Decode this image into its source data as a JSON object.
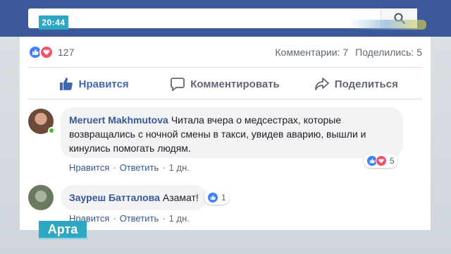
{
  "overlay": {
    "time": "20:44",
    "channel_logo": "Арта"
  },
  "header": {
    "search_placeholder": "",
    "search_icon": "search-icon"
  },
  "post": {
    "reactions": {
      "icons": [
        "like-icon",
        "love-icon"
      ],
      "count": "127"
    },
    "comments_count_label": "Комментарии: 7",
    "shares_count_label": "Поделились: 5",
    "actions": {
      "like_label": "Нравится",
      "comment_label": "Комментировать",
      "share_label": "Поделиться"
    }
  },
  "comments": [
    {
      "author": "Meruert Makhmutova",
      "text_line1": "Читала вчера о медсестрах, которые",
      "text_line2": "возвращались с ночной смены в такси, увидев аварию, вышли и",
      "text_line3": "кинулись помогать людям.",
      "reaction_count": "5",
      "like_label": "Нравится",
      "reply_label": "Ответить",
      "separator": "·",
      "time": "1 дн."
    },
    {
      "author": "Зауреш Батталова",
      "text": "Азамат!",
      "reaction_count": "1",
      "like_label": "Нравится",
      "reply_label": "Ответить",
      "separator": "·",
      "time": "1 дн."
    }
  ],
  "colors": {
    "facebook_blue": "#3b5998",
    "link_blue": "#385898",
    "like_blue": "#4080ff",
    "love_red": "#f25268",
    "overlay_cyan": "#2ea7c5"
  }
}
